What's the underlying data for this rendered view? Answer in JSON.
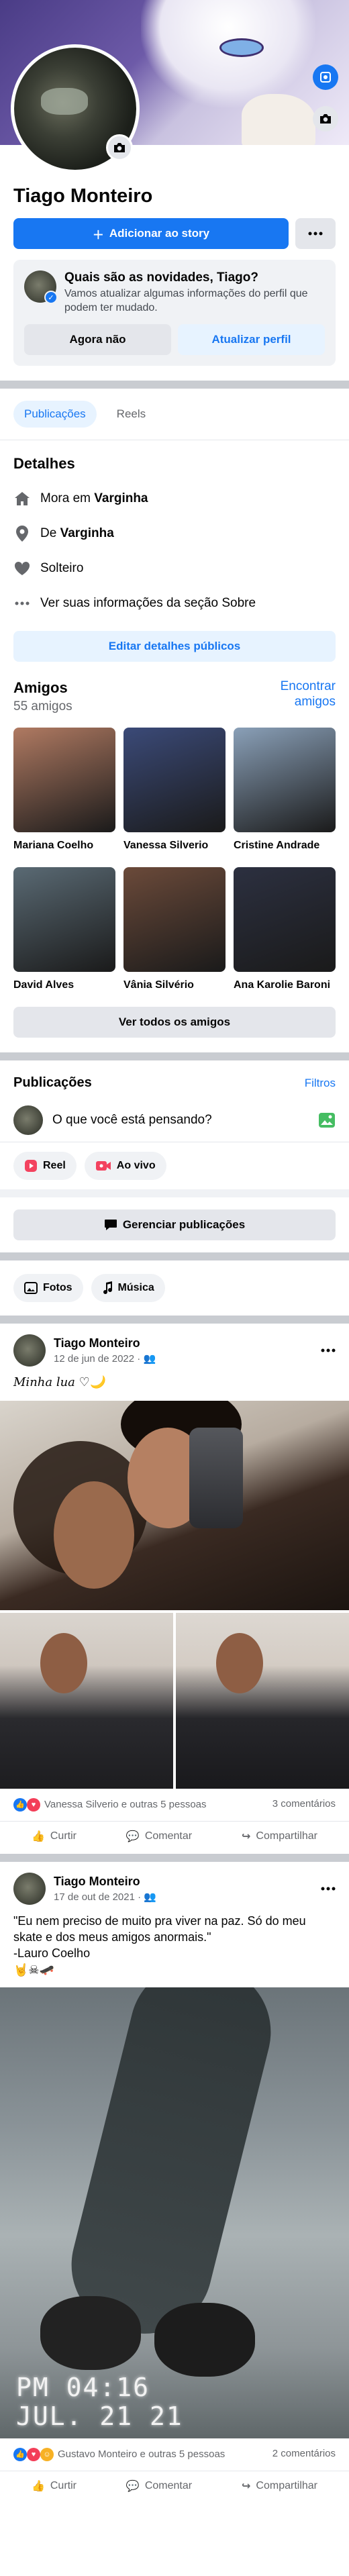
{
  "profile": {
    "name": "Tiago Monteiro",
    "add_story_label": "Adicionar ao story",
    "more_icon": "ellipsis-icon"
  },
  "story_prompt": {
    "title": "Quais são as novidades, Tiago?",
    "subtitle": "Vamos atualizar algumas informações do perfil que podem ter mudado.",
    "dismiss_label": "Agora não",
    "update_label": "Atualizar perfil"
  },
  "tabs": [
    {
      "label": "Publicações",
      "active": true
    },
    {
      "label": "Reels",
      "active": false
    }
  ],
  "details": {
    "title": "Detalhes",
    "lives_prefix": "Mora em ",
    "lives_city": "Varginha",
    "from_prefix": "De ",
    "from_city": "Varginha",
    "relationship": "Solteiro",
    "see_about": "Ver suas informações da seção Sobre",
    "edit_label": "Editar detalhes públicos"
  },
  "friends": {
    "title": "Amigos",
    "count": "55 amigos",
    "find_label": "Encontrar amigos",
    "see_all_label": "Ver todos os amigos",
    "list": [
      {
        "name": "Mariana Coelho",
        "color": "#b07a62"
      },
      {
        "name": "Vanessa Silverio",
        "color": "#3b4a78"
      },
      {
        "name": "Cristine Andrade",
        "color": "#8aa0b8"
      },
      {
        "name": "David Alves",
        "color": "#5a6a74"
      },
      {
        "name": "Vânia Silvério",
        "color": "#6b4a3a"
      },
      {
        "name": "Ana Karolie Baroni",
        "color": "#2c3040"
      }
    ]
  },
  "publications": {
    "title": "Publicações",
    "filters_label": "Filtros",
    "composer_placeholder": "O que você está pensando?",
    "reel_label": "Reel",
    "live_label": "Ao vivo",
    "manage_label": "Gerenciar publicações",
    "photos_label": "Fotos",
    "music_label": "Música"
  },
  "posts": [
    {
      "author": "Tiago Monteiro",
      "date": "12 de jun de 2022",
      "text": "Minha luа ♡🌙",
      "reactions_text": "Vanessa Silverio e outras 5 pessoas",
      "comments": "3 comentários"
    },
    {
      "author": "Tiago Monteiro",
      "date": "17 de out de 2021",
      "text": "\"Eu nem preciso de muito pra viver na paz. Só do meu skate e dos meus amigos anormais.\"\n-Lauro Coelho\n🤘☠🛹",
      "stamp_time": "PM 04:16",
      "stamp_date": "JUL. 21 21",
      "reactions_text": "Gustavo Monteiro e outras 5 pessoas",
      "comments": "2 comentários"
    }
  ],
  "post_actions": {
    "like": "Curtir",
    "comment": "Comentar",
    "share": "Compartilhar"
  },
  "colors": {
    "accent": "#1877f2",
    "light_accent": "#e7f3ff",
    "grey_button": "#e4e6eb",
    "separator": "#c9ccd1"
  }
}
